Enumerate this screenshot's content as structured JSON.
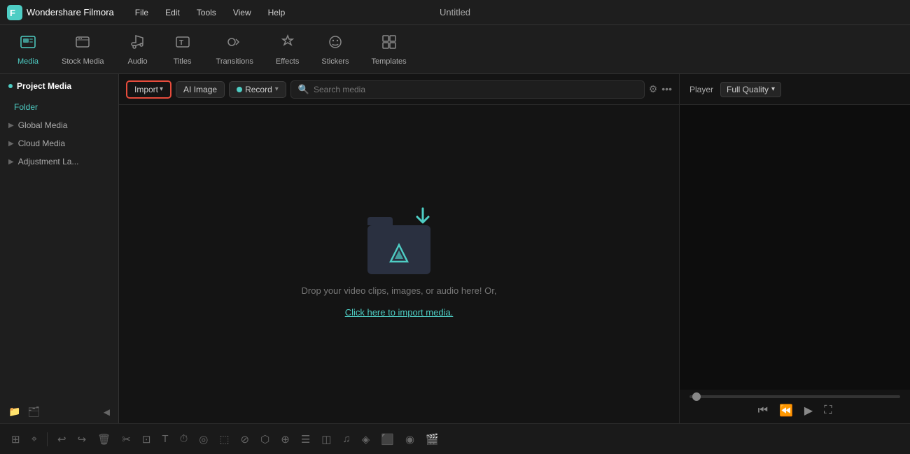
{
  "app": {
    "name": "Wondershare Filmora",
    "title": "Untitled"
  },
  "menu": {
    "items": [
      "File",
      "Edit",
      "Tools",
      "View",
      "Help"
    ]
  },
  "toolbar": {
    "items": [
      {
        "id": "media",
        "label": "Media",
        "active": true
      },
      {
        "id": "stock-media",
        "label": "Stock Media",
        "active": false
      },
      {
        "id": "audio",
        "label": "Audio",
        "active": false
      },
      {
        "id": "titles",
        "label": "Titles",
        "active": false
      },
      {
        "id": "transitions",
        "label": "Transitions",
        "active": false
      },
      {
        "id": "effects",
        "label": "Effects",
        "active": false
      },
      {
        "id": "stickers",
        "label": "Stickers",
        "active": false
      },
      {
        "id": "templates",
        "label": "Templates",
        "active": false
      }
    ]
  },
  "sidebar": {
    "header": "Project Media",
    "folder_label": "Folder",
    "items": [
      {
        "label": "Global Media"
      },
      {
        "label": "Cloud Media"
      },
      {
        "label": "Adjustment La..."
      }
    ]
  },
  "media_panel": {
    "import_label": "Import",
    "ai_image_label": "AI Image",
    "record_label": "Record",
    "search_placeholder": "Search media",
    "drop_text": "Drop your video clips, images, or audio here! Or,",
    "drop_link": "Click here to import media."
  },
  "player": {
    "label": "Player",
    "quality": "Full Quality"
  },
  "bottom_tools": [
    "⊞",
    "⌕",
    "|",
    "↩",
    "↪",
    "🗑",
    "✂",
    "⊟",
    "T",
    "⏱",
    "◎",
    "⬚",
    "⏱",
    "⬡",
    "⊕",
    "☰",
    "⊟",
    "♫",
    "◈",
    "⬛",
    "◉",
    "🎬"
  ]
}
